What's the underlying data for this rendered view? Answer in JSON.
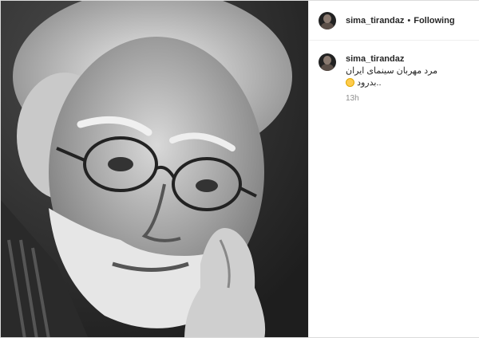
{
  "post": {
    "username": "sima_tirandaz",
    "separator": "•",
    "follow_status": "Following"
  },
  "caption": {
    "username": "sima_tirandaz",
    "text_line1": "مرد مهربان سینمای ایران",
    "text_line2": "بدرود..",
    "time": "13h"
  },
  "icons": {
    "emoji": "sad-face-emoji-icon"
  }
}
